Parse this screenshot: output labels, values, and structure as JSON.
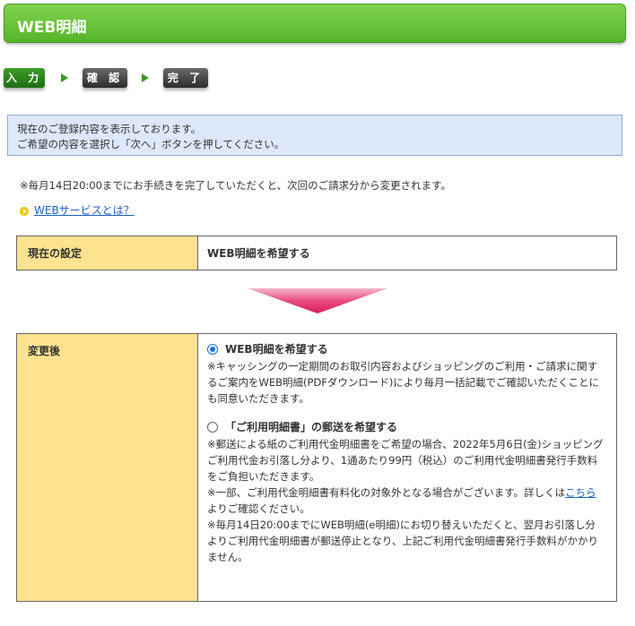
{
  "header": {
    "title": "WEB明細"
  },
  "steps": [
    {
      "label": "入 力",
      "state": "active"
    },
    {
      "label": "確 認",
      "state": "inactive"
    },
    {
      "label": "完 了",
      "state": "inactive"
    }
  ],
  "info": {
    "line1": "現在のご登録内容を表示しております。",
    "line2": "ご希望の内容を選択し「次へ」ボタンを押してください。"
  },
  "note": "※毎月14日20:00までにお手続きを完了していただくと、次回のご請求分から変更されます。",
  "web_service_link": "WEBサービスとは？",
  "current_setting": {
    "label": "現在の設定",
    "value": "WEB明細を希望する"
  },
  "after_change": {
    "label": "変更後",
    "options": [
      {
        "label": "WEB明細を希望する",
        "checked": true,
        "desc": "※キャッシングの一定期間のお取引内容およびショッピングのご利用・ご請求に関するご案内をWEB明細(PDFダウンロード)により毎月一括記載でご確認いただくことにも同意いただきます。"
      },
      {
        "label": "「ご利用明細書」の郵送を希望する",
        "checked": false,
        "desc1": "※郵送による紙のご利用代金明細書をご希望の場合、2022年5月6日(金)ショッピングご利用代金お引落し分より、1通あたり99円（税込）のご利用代金明細書発行手数料をご負担いただきます。",
        "desc2_before": "※一部、ご利用代金明細書有料化の対象外となる場合がございます。詳しくは",
        "desc2_link": "こちら",
        "desc2_after": "よりご確認ください。",
        "desc3": "※毎月14日20:00までにWEB明細(e明細)にお切り替えいただくと、翌月お引落し分よりご利用代金明細書が郵送停止となり、上記ご利用代金明細書発行手数料がかかりません。"
      }
    ]
  },
  "colors": {
    "header_green": "#57b52a",
    "label_cell": "#fde38f",
    "info_bg": "#dde8fa",
    "arrow_pink": "#e3306a"
  }
}
